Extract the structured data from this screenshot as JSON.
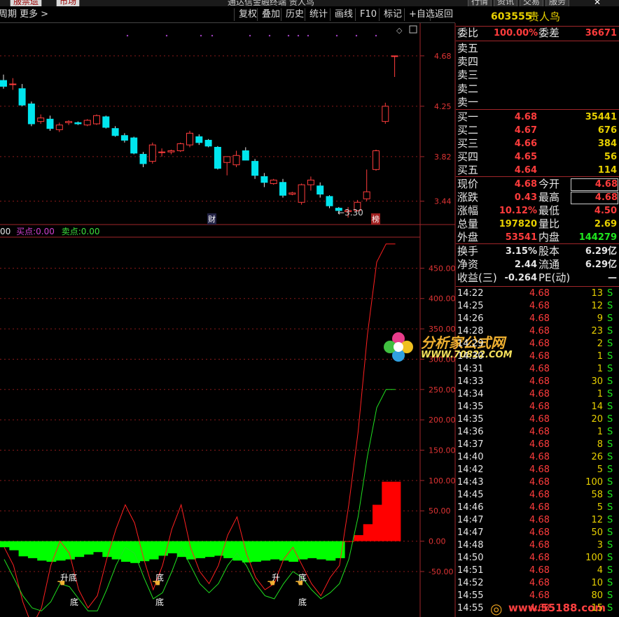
{
  "topbar": {
    "left_tab": "服禁遗",
    "right_tab": "市场",
    "title": "通达信金融终端 贵人鸟",
    "right_tabs": [
      "行情",
      "资讯",
      "交易",
      "服务"
    ]
  },
  "toolbar": {
    "period": "周期",
    "more": "更多",
    "buttons": [
      "复权",
      "叠加",
      "历史",
      "统计",
      "画线",
      "F10",
      "标记",
      "+自选",
      "返回"
    ]
  },
  "stock": {
    "code": "603555",
    "name": "贵人鸟"
  },
  "order_ratio": {
    "label1": "委比",
    "value1": "100.00%",
    "label2": "委差",
    "value2": "36671"
  },
  "asks": [
    {
      "label": "卖五",
      "price": "",
      "vol": ""
    },
    {
      "label": "卖四",
      "price": "",
      "vol": ""
    },
    {
      "label": "卖三",
      "price": "",
      "vol": ""
    },
    {
      "label": "卖二",
      "price": "",
      "vol": ""
    },
    {
      "label": "卖一",
      "price": "",
      "vol": ""
    }
  ],
  "bids": [
    {
      "label": "买一",
      "price": "4.68",
      "vol": "35441"
    },
    {
      "label": "买二",
      "price": "4.67",
      "vol": "676"
    },
    {
      "label": "买三",
      "price": "4.66",
      "vol": "384"
    },
    {
      "label": "买四",
      "price": "4.65",
      "vol": "56"
    },
    {
      "label": "买五",
      "price": "4.64",
      "vol": "114"
    }
  ],
  "quote": [
    {
      "l1": "现价",
      "v1": "4.68",
      "l2": "今开",
      "v2": "4.68"
    },
    {
      "l1": "涨跌",
      "v1": "0.43",
      "l2": "最高",
      "v2": "4.68"
    },
    {
      "l1": "涨幅",
      "v1": "10.12%",
      "l2": "最低",
      "v2": "4.50"
    },
    {
      "l1": "总量",
      "v1": "197820",
      "l2": "量比",
      "v2": "2.69"
    },
    {
      "l1": "外盘",
      "v1": "53541",
      "l2": "内盘",
      "v2": "144279"
    }
  ],
  "fundamentals": [
    {
      "l1": "换手",
      "v1": "3.15%",
      "l2": "股本",
      "v2": "6.29亿"
    },
    {
      "l1": "净资",
      "v1": "2.44",
      "l2": "流通",
      "v2": "6.29亿"
    },
    {
      "l1": "收益(三)",
      "v1": "-0.264",
      "l2": "PE(动)",
      "v2": "—"
    }
  ],
  "ticks": [
    {
      "t": "14:22",
      "p": "4.68",
      "v": "13",
      "s": "S"
    },
    {
      "t": "14:25",
      "p": "4.68",
      "v": "12",
      "s": "S"
    },
    {
      "t": "14:26",
      "p": "4.68",
      "v": "9",
      "s": "S"
    },
    {
      "t": "14:28",
      "p": "4.68",
      "v": "23",
      "s": "S"
    },
    {
      "t": "14:29",
      "p": "4.68",
      "v": "2",
      "s": "S"
    },
    {
      "t": "14:30",
      "p": "4.68",
      "v": "1",
      "s": "S"
    },
    {
      "t": "14:31",
      "p": "4.68",
      "v": "1",
      "s": "S"
    },
    {
      "t": "14:33",
      "p": "4.68",
      "v": "30",
      "s": "S"
    },
    {
      "t": "14:34",
      "p": "4.68",
      "v": "1",
      "s": "S"
    },
    {
      "t": "14:35",
      "p": "4.68",
      "v": "14",
      "s": "S"
    },
    {
      "t": "14:35",
      "p": "4.68",
      "v": "20",
      "s": "S"
    },
    {
      "t": "14:36",
      "p": "4.68",
      "v": "1",
      "s": "S"
    },
    {
      "t": "14:37",
      "p": "4.68",
      "v": "8",
      "s": "S"
    },
    {
      "t": "14:40",
      "p": "4.68",
      "v": "26",
      "s": "S"
    },
    {
      "t": "14:42",
      "p": "4.68",
      "v": "5",
      "s": "S"
    },
    {
      "t": "14:43",
      "p": "4.68",
      "v": "100",
      "s": "S"
    },
    {
      "t": "14:45",
      "p": "4.68",
      "v": "58",
      "s": "S"
    },
    {
      "t": "14:46",
      "p": "4.68",
      "v": "5",
      "s": "S"
    },
    {
      "t": "14:47",
      "p": "4.68",
      "v": "12",
      "s": "S"
    },
    {
      "t": "14:47",
      "p": "4.68",
      "v": "50",
      "s": "S"
    },
    {
      "t": "14:48",
      "p": "4.68",
      "v": "3",
      "s": "S"
    },
    {
      "t": "14:50",
      "p": "4.68",
      "v": "100",
      "s": "S"
    },
    {
      "t": "14:51",
      "p": "4.68",
      "v": "4",
      "s": "S"
    },
    {
      "t": "14:52",
      "p": "4.68",
      "v": "10",
      "s": "S"
    },
    {
      "t": "14:55",
      "p": "4.68",
      "v": "80",
      "s": "S"
    },
    {
      "t": "14:55",
      "p": "4.68",
      "v": "15",
      "s": "S"
    }
  ],
  "indicator_header": {
    "prefix": "00",
    "buy_label": "买点:",
    "buy_value": "0.00",
    "sell_label": "卖点:",
    "sell_value": "0.00"
  },
  "watermark": {
    "title": "分析家公式网",
    "url": "WWW.70822.COM",
    "bottom_url": "www.55188.com"
  },
  "colors": {
    "up": "#ff3c3c",
    "down": "#00e5ee",
    "bull": "#ff0000",
    "bear": "#00ff00",
    "grid": "#8b1a1a"
  },
  "chart_data": [
    {
      "type": "candlestick",
      "title": "",
      "y_ticks": [
        3.44,
        3.82,
        4.25,
        4.68
      ],
      "ylim": [
        3.3,
        4.9
      ],
      "annotations": {
        "low_label": "3.30",
        "marker_cai": "财",
        "marker_bang": "榜"
      },
      "candles": [
        {
          "o": 4.47,
          "h": 4.52,
          "l": 4.4,
          "c": 4.42
        },
        {
          "o": 4.44,
          "h": 4.49,
          "l": 4.39,
          "c": 4.44
        },
        {
          "o": 4.4,
          "h": 4.44,
          "l": 4.25,
          "c": 4.26
        },
        {
          "o": 4.27,
          "h": 4.29,
          "l": 4.08,
          "c": 4.1
        },
        {
          "o": 4.12,
          "h": 4.18,
          "l": 4.1,
          "c": 4.15
        },
        {
          "o": 4.14,
          "h": 4.17,
          "l": 4.04,
          "c": 4.06
        },
        {
          "o": 4.05,
          "h": 4.11,
          "l": 4.03,
          "c": 4.09
        },
        {
          "o": 4.11,
          "h": 4.13,
          "l": 4.09,
          "c": 4.12
        },
        {
          "o": 4.11,
          "h": 4.12,
          "l": 4.09,
          "c": 4.1
        },
        {
          "o": 4.09,
          "h": 4.14,
          "l": 4.08,
          "c": 4.13
        },
        {
          "o": 4.1,
          "h": 4.18,
          "l": 4.09,
          "c": 4.17
        },
        {
          "o": 4.16,
          "h": 4.17,
          "l": 4.06,
          "c": 4.07
        },
        {
          "o": 4.06,
          "h": 4.08,
          "l": 3.99,
          "c": 4.0
        },
        {
          "o": 4.0,
          "h": 4.02,
          "l": 3.94,
          "c": 3.96
        },
        {
          "o": 3.98,
          "h": 3.99,
          "l": 3.84,
          "c": 3.85
        },
        {
          "o": 3.84,
          "h": 3.86,
          "l": 3.73,
          "c": 3.76
        },
        {
          "o": 3.78,
          "h": 3.94,
          "l": 3.76,
          "c": 3.92
        },
        {
          "o": 3.86,
          "h": 3.89,
          "l": 3.82,
          "c": 3.86
        },
        {
          "o": 3.86,
          "h": 3.88,
          "l": 3.84,
          "c": 3.87
        },
        {
          "o": 3.87,
          "h": 3.94,
          "l": 3.86,
          "c": 3.93
        },
        {
          "o": 3.92,
          "h": 4.04,
          "l": 3.9,
          "c": 4.02
        },
        {
          "o": 3.99,
          "h": 4.01,
          "l": 3.92,
          "c": 3.94
        },
        {
          "o": 3.96,
          "h": 3.97,
          "l": 3.9,
          "c": 3.91
        },
        {
          "o": 3.9,
          "h": 3.91,
          "l": 3.71,
          "c": 3.72
        },
        {
          "o": 3.77,
          "h": 3.82,
          "l": 3.66,
          "c": 3.82
        },
        {
          "o": 3.75,
          "h": 3.87,
          "l": 3.73,
          "c": 3.83
        },
        {
          "o": 3.87,
          "h": 3.9,
          "l": 3.79,
          "c": 3.79
        },
        {
          "o": 3.78,
          "h": 3.8,
          "l": 3.63,
          "c": 3.66
        },
        {
          "o": 3.65,
          "h": 3.68,
          "l": 3.56,
          "c": 3.6
        },
        {
          "o": 3.59,
          "h": 3.63,
          "l": 3.58,
          "c": 3.62
        },
        {
          "o": 3.6,
          "h": 3.63,
          "l": 3.47,
          "c": 3.49
        },
        {
          "o": 3.5,
          "h": 3.52,
          "l": 3.49,
          "c": 3.51
        },
        {
          "o": 3.43,
          "h": 3.59,
          "l": 3.41,
          "c": 3.58
        },
        {
          "o": 3.58,
          "h": 3.65,
          "l": 3.53,
          "c": 3.62
        },
        {
          "o": 3.57,
          "h": 3.6,
          "l": 3.47,
          "c": 3.5
        },
        {
          "o": 3.48,
          "h": 3.49,
          "l": 3.38,
          "c": 3.4
        },
        {
          "o": 3.38,
          "h": 3.39,
          "l": 3.33,
          "c": 3.36
        },
        {
          "o": 3.35,
          "h": 3.39,
          "l": 3.3,
          "c": 3.36
        },
        {
          "o": 3.36,
          "h": 3.45,
          "l": 3.35,
          "c": 3.43
        },
        {
          "o": 3.46,
          "h": 3.71,
          "l": 3.44,
          "c": 3.52
        },
        {
          "o": 3.71,
          "h": 3.88,
          "l": 3.7,
          "c": 3.87
        },
        {
          "o": 4.12,
          "h": 4.28,
          "l": 4.1,
          "c": 4.25
        },
        {
          "o": 4.68,
          "h": 4.68,
          "l": 4.5,
          "c": 4.68
        }
      ]
    },
    {
      "type": "bar",
      "title": "",
      "y_ticks": [
        -50.0,
        0.0,
        50.0,
        100.0,
        150.0,
        200.0,
        250.0,
        300.0,
        350.0,
        400.0,
        450.0
      ],
      "ylim": [
        -125,
        500
      ],
      "labels": [
        {
          "text": "升底",
          "at": 6
        },
        {
          "text": "底",
          "at": 7
        },
        {
          "text": "底",
          "at": 15
        },
        {
          "text": "底",
          "at": 15
        },
        {
          "text": "升",
          "at": 27
        },
        {
          "text": "底",
          "at": 30
        },
        {
          "text": "底",
          "at": 30
        }
      ],
      "histogram": [
        -10,
        -15,
        -25,
        -28,
        -32,
        -34,
        -32,
        -30,
        -26,
        -22,
        -18,
        -26,
        -30,
        -34,
        -36,
        -33,
        -30,
        -24,
        -20,
        -26,
        -30,
        -28,
        -26,
        -24,
        -28,
        -32,
        -35,
        -34,
        -32,
        -30,
        -32,
        -34,
        -30,
        -28,
        -30,
        -32,
        -28,
        0,
        10,
        28,
        60,
        98,
        98
      ],
      "red_line": [
        -10,
        -40,
        -100,
        -140,
        -110,
        -40,
        0,
        -20,
        -80,
        -110,
        -90,
        -30,
        20,
        60,
        30,
        -30,
        -80,
        -40,
        20,
        60,
        -10,
        -50,
        -70,
        -40,
        10,
        40,
        -20,
        -60,
        -80,
        -70,
        -30,
        -10,
        -40,
        -70,
        -90,
        -60,
        -40,
        60,
        180,
        340,
        460,
        490,
        490
      ],
      "green_line": [
        -30,
        -60,
        -90,
        -110,
        -115,
        -100,
        -70,
        -75,
        -95,
        -115,
        -115,
        -80,
        -40,
        -10,
        -20,
        -60,
        -95,
        -85,
        -50,
        -10,
        -40,
        -70,
        -85,
        -70,
        -40,
        -20,
        -40,
        -70,
        -90,
        -95,
        -70,
        -50,
        -60,
        -80,
        -95,
        -85,
        -70,
        -30,
        40,
        140,
        220,
        250,
        250
      ]
    }
  ]
}
